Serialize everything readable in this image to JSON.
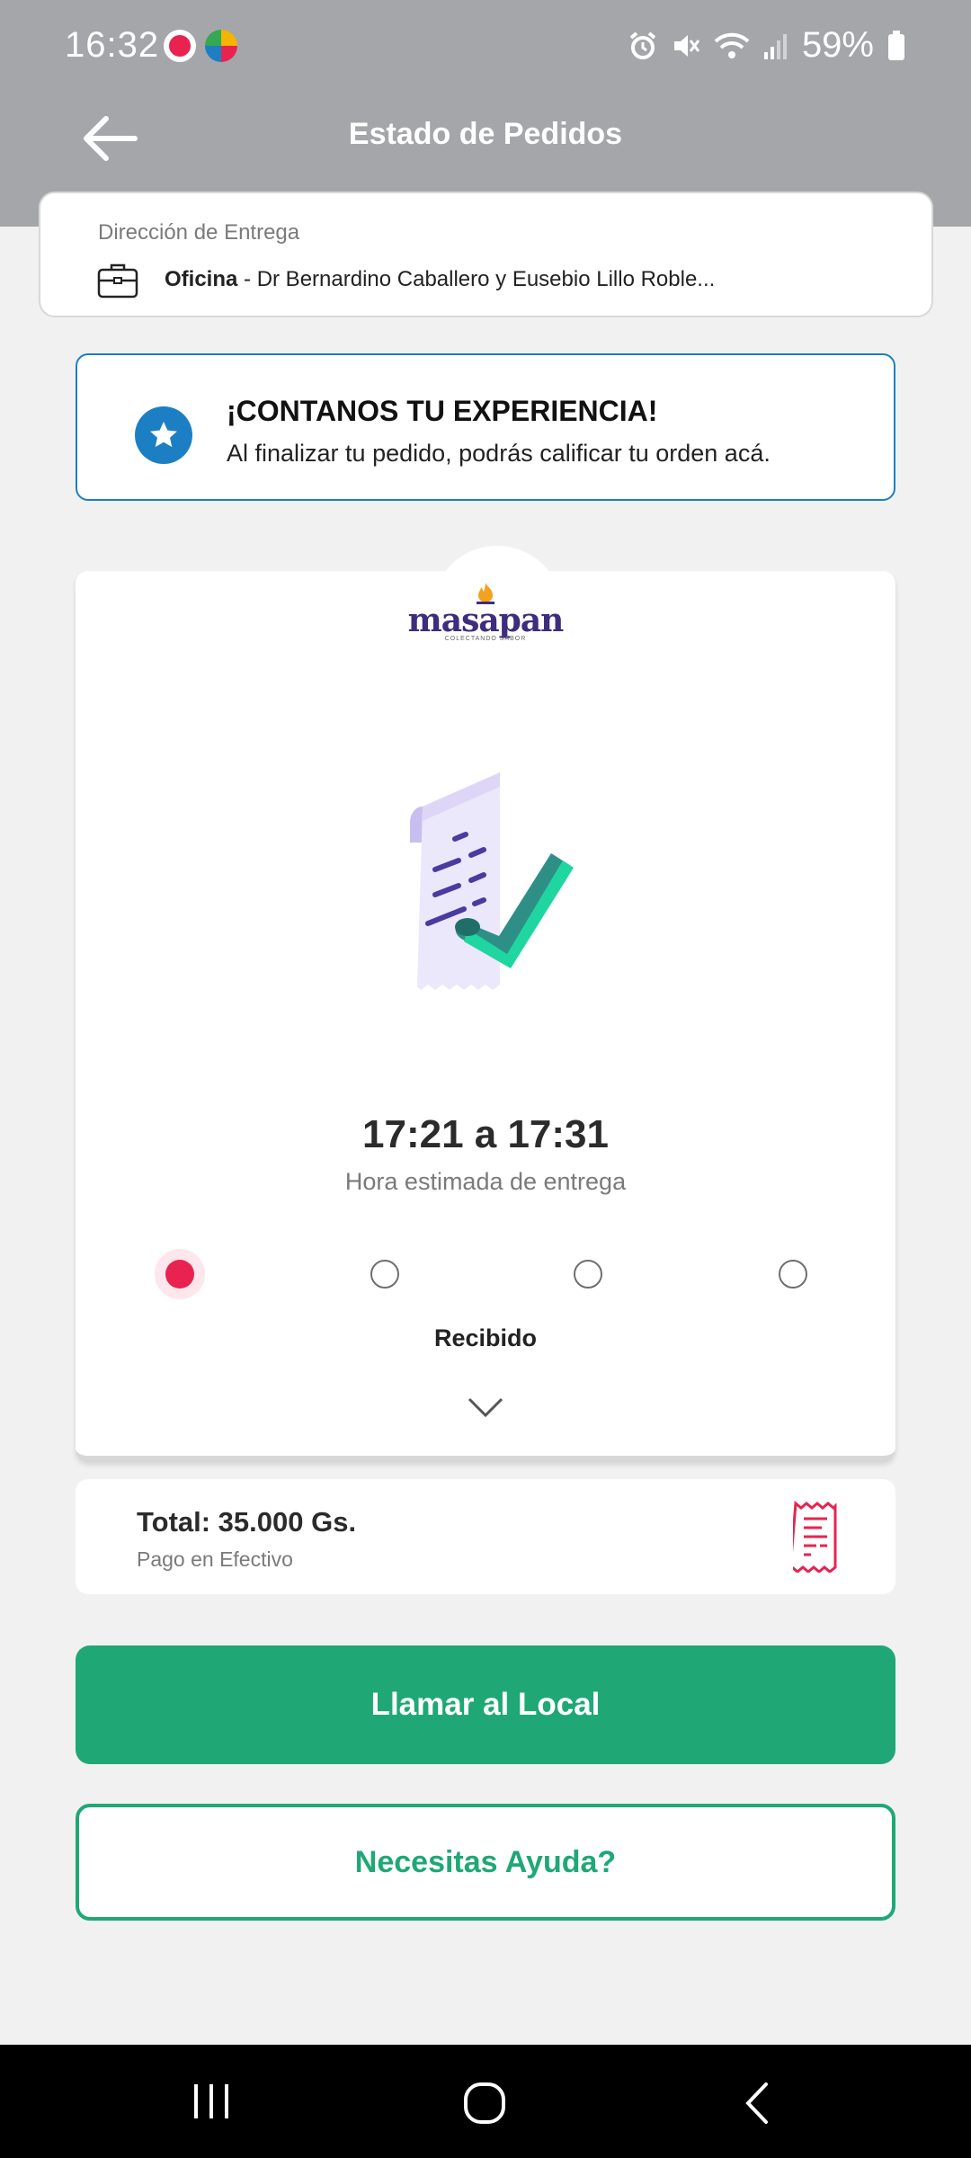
{
  "status_bar": {
    "time": "16:32",
    "battery": "59%",
    "battery_level": 0.59
  },
  "header": {
    "title": "Estado de Pedidos",
    "back_icon": "arrow-left-icon"
  },
  "address": {
    "label": "Dirección de Entrega",
    "place_name": "Oficina",
    "place_detail": " - Dr Bernardino Caballero y Eusebio Lillo Roble...",
    "icon": "briefcase-icon"
  },
  "experience": {
    "title": "¡CONTANOS TU EXPERIENCIA!",
    "subtitle": "Al finalizar tu pedido, podrás calificar tu orden acá.",
    "icon": "star-icon",
    "color": "#1c7fc4"
  },
  "order": {
    "logo_text": "masapan",
    "logo_tagline": "COLECTANDO SABOR",
    "eta": "17:21 a 17:31",
    "eta_label": "Hora estimada de entrega",
    "steps_total": 4,
    "current_step": 1,
    "step_label": "Recibido",
    "active_color": "#e8234f"
  },
  "total": {
    "amount": "Total: 35.000 Gs.",
    "payment": "Pago en Efectivo",
    "icon": "receipt-icon"
  },
  "actions": {
    "call_label": "Llamar al Local",
    "help_label": "Necesitas Ayuda?",
    "accent": "#1fa876"
  }
}
